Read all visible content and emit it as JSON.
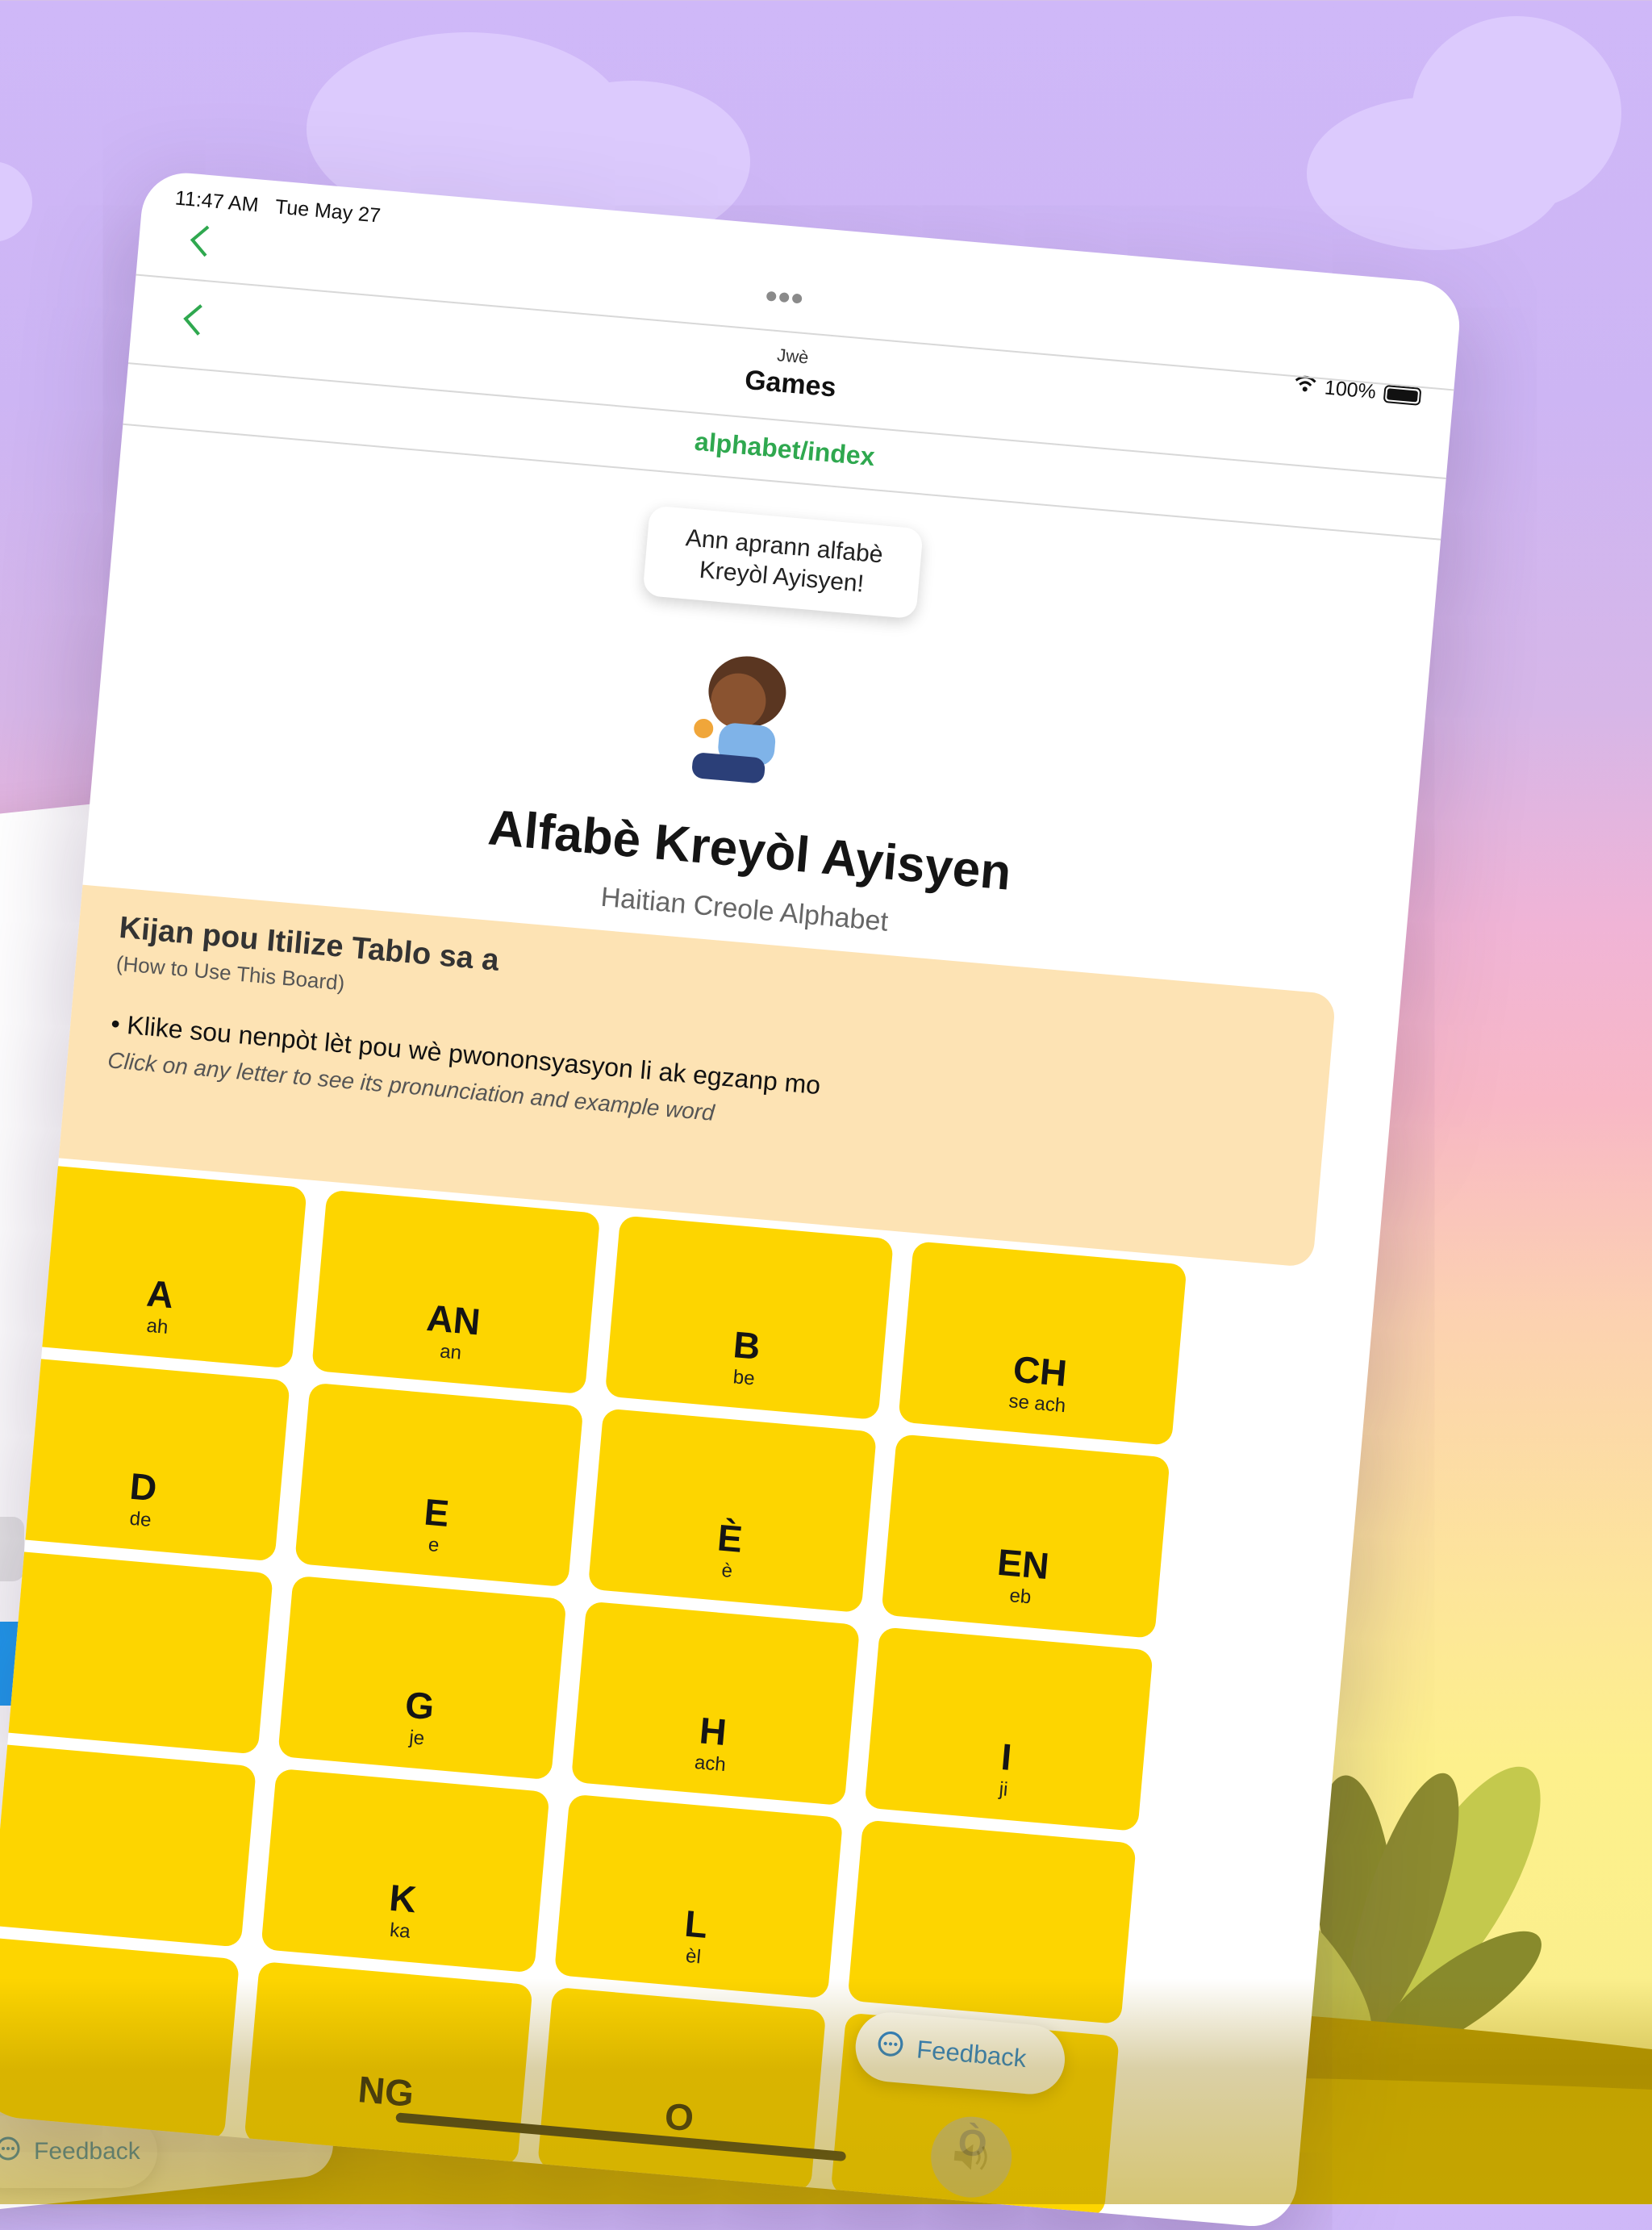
{
  "status_bar": {
    "time": "11:47 AM",
    "date": "Tue May 27",
    "battery": "100%"
  },
  "nav": {
    "subtitle": "Jwè",
    "title": "Games",
    "route": "alphabet/index"
  },
  "speech_bubble": "Ann aprann alfabè Kreyòl Ayisyen!",
  "heading": "Alfabè Kreyòl Ayisyen",
  "subheading": "Haitian Creole Alphabet",
  "instructions": {
    "title": "Kijan pou Itilize Tablo sa a",
    "title_translation": "(How to Use This Board)",
    "bullet": "• Klike sou nenpòt lèt pou wè pwononsyasyon li ak egzanp mo",
    "bullet_translation": "Click on any letter to see its pronunciation and example word"
  },
  "letters": [
    {
      "letter": "A",
      "sound": "ah"
    },
    {
      "letter": "AN",
      "sound": "an"
    },
    {
      "letter": "B",
      "sound": "be"
    },
    {
      "letter": "CH",
      "sound": "se ach"
    },
    {
      "letter": "D",
      "sound": "de"
    },
    {
      "letter": "E",
      "sound": "e"
    },
    {
      "letter": "È",
      "sound": "è"
    },
    {
      "letter": "EN",
      "sound": "eb"
    },
    {
      "letter": "",
      "sound": ""
    },
    {
      "letter": "G",
      "sound": "je"
    },
    {
      "letter": "H",
      "sound": "ach"
    },
    {
      "letter": "I",
      "sound": "ji"
    },
    {
      "letter": "",
      "sound": ""
    },
    {
      "letter": "K",
      "sound": "ka"
    },
    {
      "letter": "L",
      "sound": "èl"
    },
    {
      "letter": "",
      "sound": ""
    },
    {
      "letter": "",
      "sound": ""
    },
    {
      "letter": "NG",
      "sound": ""
    },
    {
      "letter": "O",
      "sound": ""
    },
    {
      "letter": "Ò",
      "sound": ""
    }
  ],
  "feedback_label": "Feedback",
  "left_feedback_label": "Feedback",
  "colors": {
    "accent_green": "#2fa84f",
    "tile_yellow": "#fdd500",
    "info_bg": "#fde3b4",
    "link_blue": "#1a7ee0"
  },
  "icons": [
    "chevron-left-icon",
    "more-dots-icon",
    "wifi-icon",
    "battery-icon",
    "chat-bubble-icon",
    "speaker-icon"
  ]
}
